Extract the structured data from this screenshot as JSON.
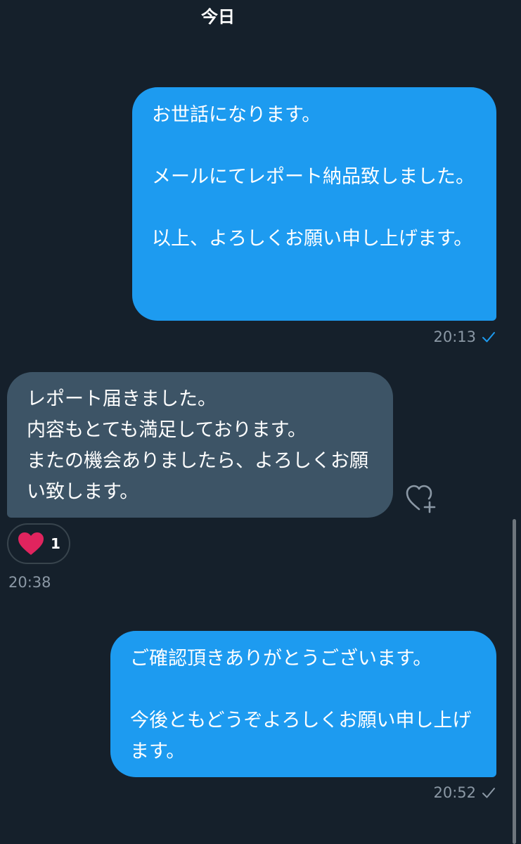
{
  "conversation": {
    "date_header": "今日",
    "messages": [
      {
        "direction": "sent",
        "text": "お世話になります。\n\nメールにてレポート納品致しました。\n\n以上、よろしくお願い申し上げます。",
        "time": "20:13",
        "status": "read"
      },
      {
        "direction": "received",
        "text": "レポート届きました。\n内容もとても満足しております。\nまたの機会ありましたら、よろしくお願い致します。",
        "time": "20:38",
        "reaction": {
          "icon": "heart-icon",
          "color": "#e0245e",
          "count": "1"
        }
      },
      {
        "direction": "sent",
        "text": "ご確認頂きありがとうございます。\n\n今後ともどうぞよろしくお願い申し上げます。",
        "time": "20:52",
        "status": "sent"
      }
    ]
  },
  "colors": {
    "background": "#15202b",
    "sent_bubble": "#1d9bf0",
    "received_bubble": "#3d5466",
    "meta_text": "#8b98a5",
    "read_check": "#1d9bf0"
  },
  "icons": {
    "add_reaction": "heart-plus-icon",
    "read_check": "checkmark-icon"
  }
}
